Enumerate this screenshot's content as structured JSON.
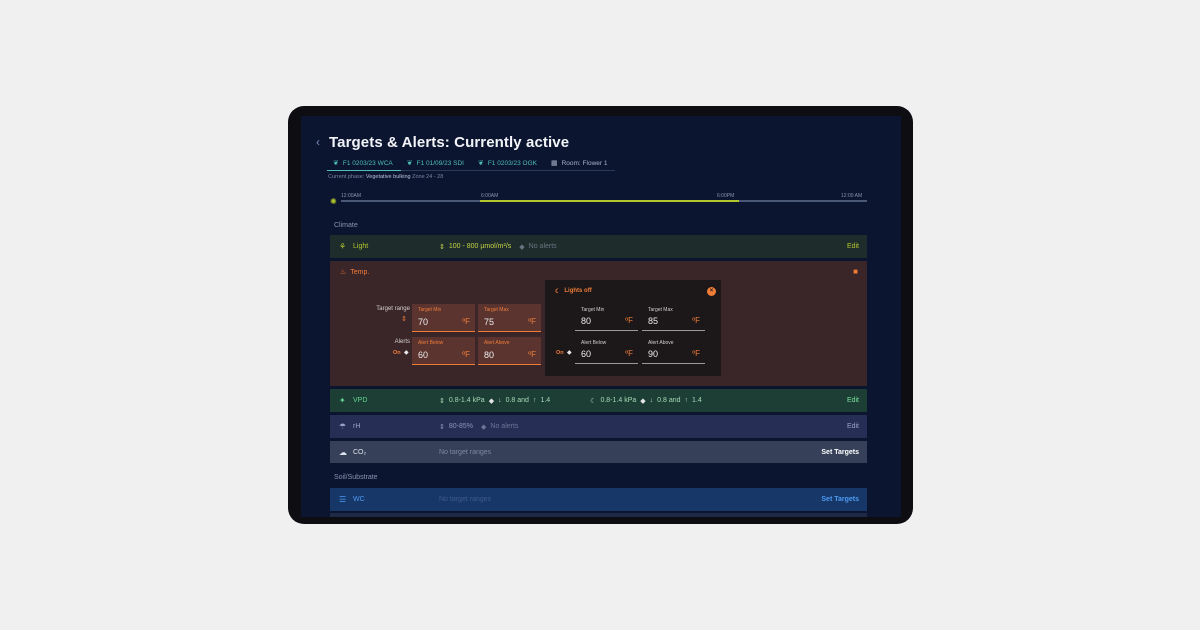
{
  "header": {
    "back_icon": "chevron-left-icon",
    "title": "Targets & Alerts: Currently active"
  },
  "tabs": [
    {
      "label": "F1 0203/23 WCA",
      "icon": "plant-icon",
      "active": true
    },
    {
      "label": "F1 01/09/23 SDI",
      "icon": "plant-icon",
      "active": false
    },
    {
      "label": "F1 0203/23 OGK",
      "icon": "plant-icon",
      "active": false
    },
    {
      "label": "Room: Flower 1",
      "icon": "grid-icon",
      "active": false
    }
  ],
  "phase": {
    "prefix": "Current phase:",
    "value": "Vegetative bulking",
    "zone": "Zone 24 - 28"
  },
  "timeline": {
    "labels": [
      "12:00AM",
      "6:00AM",
      "6:00PM",
      "12:00 AM"
    ],
    "lights_on_fraction": [
      0.25,
      0.75
    ],
    "accent": "#b3c62c"
  },
  "sections": {
    "climate": "Climate",
    "soil": "Soil/Substrate"
  },
  "light": {
    "name": "Light",
    "range": "100 - 800 µmol/m²/s",
    "alerts": "No alerts",
    "action": "Edit"
  },
  "temp": {
    "name": "Temp.",
    "target_range_label": "Target range",
    "alerts_label": "Alerts",
    "on_label": "On",
    "fields": {
      "target_min": {
        "label": "Target Min",
        "value": "70",
        "unit": "ºF"
      },
      "target_max": {
        "label": "Target Max",
        "value": "75",
        "unit": "ºF"
      },
      "alert_below": {
        "label": "Alert Below",
        "value": "60",
        "unit": "ºF"
      },
      "alert_above": {
        "label": "Alert Above",
        "value": "80",
        "unit": "ºF"
      }
    },
    "popup": {
      "title": "Lights off",
      "on_label": "On",
      "target_min": {
        "label": "Target Min",
        "value": "80",
        "unit": "ºF"
      },
      "target_max": {
        "label": "Target Max",
        "value": "85",
        "unit": "ºF"
      },
      "alert_below": {
        "label": "Alert Below",
        "value": "60",
        "unit": "ºF"
      },
      "alert_above": {
        "label": "Alert Above",
        "value": "90",
        "unit": "ºF"
      }
    },
    "accent": "#ef7d38"
  },
  "vpd": {
    "name": "VPD",
    "day_range": "0.8-1.4 kPa",
    "day_below": "0.8 and",
    "day_above": "1.4",
    "night_range": "0.8-1.4 kPa",
    "night_below": "0.8 and",
    "night_above": "1.4",
    "action": "Edit"
  },
  "rh": {
    "name": "rH",
    "range": "80-85%",
    "alerts": "No alerts",
    "action": "Edit"
  },
  "co2": {
    "name": "CO₂",
    "range": "No target ranges",
    "action": "Set Targets"
  },
  "wc": {
    "name": "WC",
    "range": "No target ranges",
    "action": "Set Targets"
  }
}
